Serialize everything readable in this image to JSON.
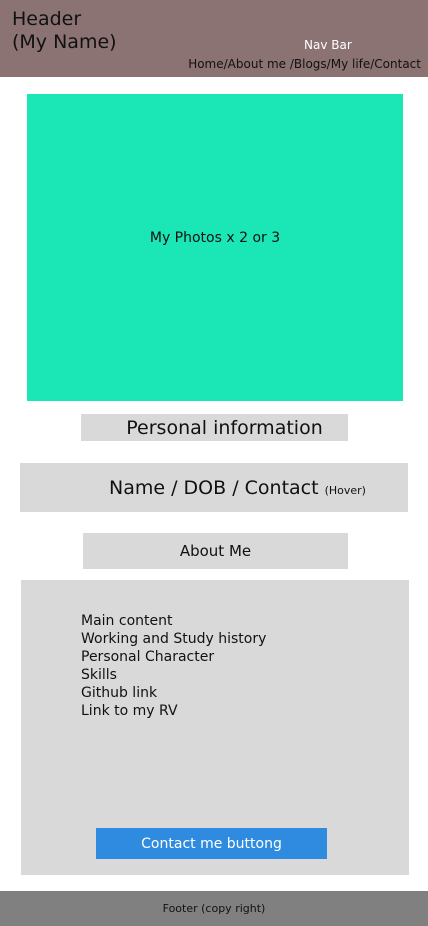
{
  "header": {
    "title": "Header\n(My Name)",
    "nav_label": "Nav Bar",
    "nav_links": "Home/About me /Blogs/My life/Contact"
  },
  "photos": {
    "label": "My Photos x 2 or 3"
  },
  "personal_info": {
    "label": "Personal information"
  },
  "name_bar": {
    "label": "Name / DOB / Contact",
    "hover_note": "(Hover)"
  },
  "about": {
    "label": "About Me"
  },
  "content": {
    "items": [
      "Main content",
      "Working and Study history",
      "Personal Character",
      "Skills",
      "Github link",
      "Link to my RV"
    ]
  },
  "contact_button": {
    "label": "Contact me buttong"
  },
  "footer": {
    "label": "Footer (copy right)"
  },
  "colors": {
    "header_bg": "#8b7373",
    "photos_bg": "#1be6b6",
    "panel_bg": "#d9d9d9",
    "button_bg": "#2f8be0",
    "footer_bg": "#808080"
  }
}
